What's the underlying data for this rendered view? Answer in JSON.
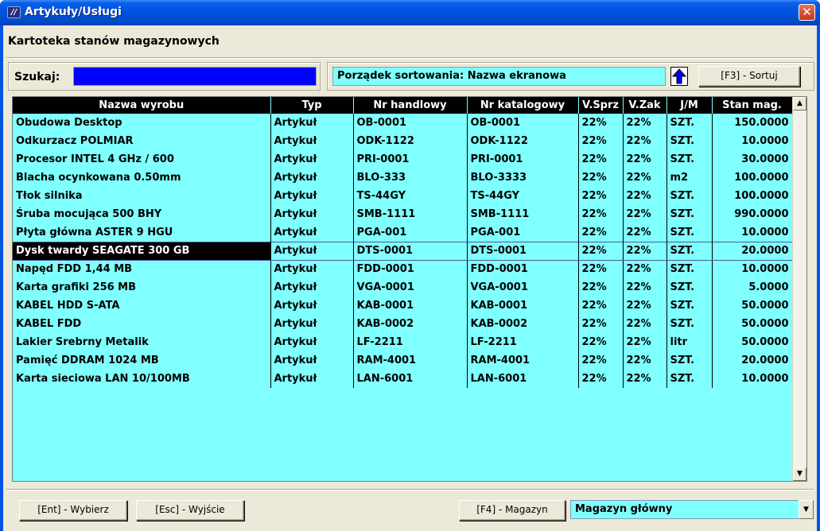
{
  "window": {
    "icon_glyph": "//",
    "title": "Artykuły/Usługi",
    "close_glyph": "✕"
  },
  "form": {
    "title": "Kartoteka stanów magazynowych"
  },
  "search": {
    "label": "Szukaj:",
    "value": ""
  },
  "sort": {
    "label": "Porządek sortowania: Nazwa ekranowa",
    "direction_icon": "arrow-up-icon",
    "button_label": "[F3] - Sortuj"
  },
  "grid": {
    "columns": [
      "Nazwa wyrobu",
      "Typ",
      "Nr handlowy",
      "Nr katalogowy",
      "V.Sprz",
      "V.Zak",
      "J/M",
      "Stan mag."
    ],
    "selected_row": 7,
    "rows": [
      [
        "Obudowa Desktop",
        "Artykuł",
        "OB-0001",
        "OB-0001",
        "22%",
        "22%",
        "SZT.",
        "150.0000"
      ],
      [
        "Odkurzacz POLMIAR",
        "Artykuł",
        "ODK-1122",
        "ODK-1122",
        "22%",
        "22%",
        "SZT.",
        "10.0000"
      ],
      [
        "Procesor INTEL 4 GHz / 600",
        "Artykuł",
        "PRI-0001",
        "PRI-0001",
        "22%",
        "22%",
        "SZT.",
        "30.0000"
      ],
      [
        "Blacha ocynkowana 0.50mm",
        "Artykuł",
        "BLO-333",
        "BLO-3333",
        "22%",
        "22%",
        "m2",
        "100.0000"
      ],
      [
        "Tłok silnika",
        "Artykuł",
        "TS-44GY",
        "TS-44GY",
        "22%",
        "22%",
        "SZT.",
        "100.0000"
      ],
      [
        "Śruba mocująca 500 BHY",
        "Artykuł",
        "SMB-1111",
        "SMB-1111",
        "22%",
        "22%",
        "SZT.",
        "990.0000"
      ],
      [
        "Płyta główna ASTER 9 HGU",
        "Artykuł",
        "PGA-001",
        "PGA-001",
        "22%",
        "22%",
        "SZT.",
        "10.0000"
      ],
      [
        "Dysk twardy SEAGATE 300 GB",
        "Artykuł",
        "DTS-0001",
        "DTS-0001",
        "22%",
        "22%",
        "SZT.",
        "20.0000"
      ],
      [
        "Napęd FDD 1,44 MB",
        "Artykuł",
        "FDD-0001",
        "FDD-0001",
        "22%",
        "22%",
        "SZT.",
        "10.0000"
      ],
      [
        "Karta grafiki 256 MB",
        "Artykuł",
        "VGA-0001",
        "VGA-0001",
        "22%",
        "22%",
        "SZT.",
        "5.0000"
      ],
      [
        "KABEL HDD S-ATA",
        "Artykuł",
        "KAB-0001",
        "KAB-0001",
        "22%",
        "22%",
        "SZT.",
        "50.0000"
      ],
      [
        "KABEL FDD",
        "Artykuł",
        "KAB-0002",
        "KAB-0002",
        "22%",
        "22%",
        "SZT.",
        "50.0000"
      ],
      [
        "Lakier Srebrny Metalik",
        "Artykuł",
        "LF-2211",
        "LF-2211",
        "22%",
        "22%",
        "litr",
        "50.0000"
      ],
      [
        "Pamięć DDRAM 1024 MB",
        "Artykuł",
        "RAM-4001",
        "RAM-4001",
        "22%",
        "22%",
        "SZT.",
        "20.0000"
      ],
      [
        "Karta sieciowa LAN 10/100MB",
        "Artykuł",
        "LAN-6001",
        "LAN-6001",
        "22%",
        "22%",
        "SZT.",
        "10.0000"
      ]
    ],
    "scroll_up_glyph": "▲",
    "scroll_down_glyph": "▼"
  },
  "footer": {
    "select_button": "[Ent] - Wybierz",
    "exit_button": "[Esc] - Wyjście",
    "warehouse_button": "[F4] - Magazyn",
    "warehouse_value": "Magazyn główny",
    "warehouse_drop_glyph": "▼"
  },
  "colors": {
    "title_bar": "#0054e3",
    "grid_background": "#80ffff",
    "search_background": "#0000ff",
    "header_background": "#000000"
  }
}
